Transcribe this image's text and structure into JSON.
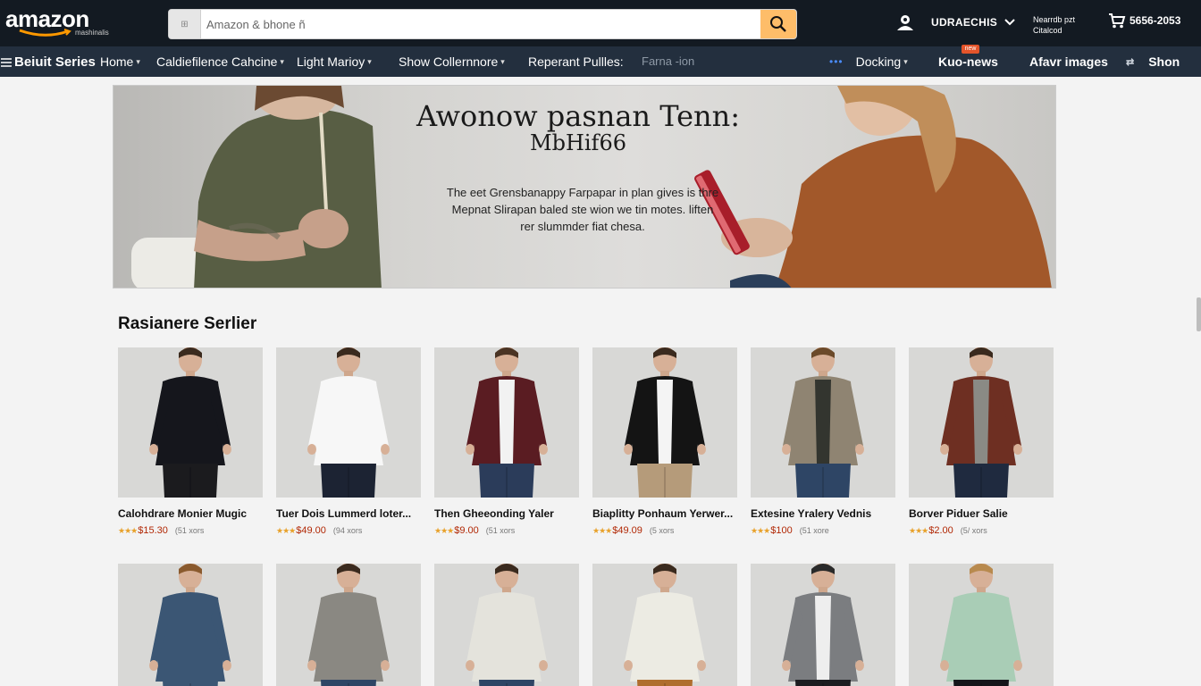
{
  "header": {
    "logo_text": "amazon",
    "logo_sub": "mashinalis",
    "search_placeholder": "Amazon & bhone ñ",
    "account_label": "UDRAECHIS",
    "orders_line1": "Nearrdb pzt",
    "orders_line2": "Citalcod",
    "cart_text": "5656-2053"
  },
  "nav": {
    "items": [
      {
        "label": "Beiuit Series",
        "style": "bold",
        "caret": false
      },
      {
        "label": "Home",
        "style": "normal",
        "caret": true
      },
      {
        "label": "Caldiefilence Cahcine",
        "style": "normal",
        "caret": true
      },
      {
        "label": "Light Marioy",
        "style": "normal",
        "caret": true
      },
      {
        "label": "Show Collernnore",
        "style": "normal",
        "caret": true
      },
      {
        "label": "Reperant Pullles:",
        "style": "normal",
        "caret": false
      },
      {
        "label": "Farna -ion",
        "style": "dim",
        "caret": false
      },
      {
        "label": "Docking",
        "style": "normal",
        "caret": true
      },
      {
        "label": "Kuo-news",
        "style": "bold",
        "caret": false
      },
      {
        "label": "Afavr images",
        "style": "bold",
        "caret": false
      },
      {
        "label": "Shon",
        "style": "bold",
        "caret": false
      }
    ],
    "badge": "new"
  },
  "hero": {
    "title": "Awonow pasnan Tenn:",
    "subtitle": "MbHif66",
    "body": "The eet Grensbanappy Farpapar in plan gives is thre Mepnat Slirapan baled ste wion we tin motes. liften rer slummder fiat chesa."
  },
  "section": {
    "title": "Rasianere Serlier"
  },
  "products": [
    {
      "name": "Calohdrare Monier Mugic",
      "price": "$15.30",
      "reviews": "(51 xors",
      "shirt": "#15161c",
      "pants": "#1b1b1e",
      "inner": "#15161c",
      "open": false,
      "hair": "#3a2a1e"
    },
    {
      "name": "Tuer Dois Lummerd loter...",
      "price": "$49.00",
      "reviews": "(94 xors",
      "shirt": "#f7f7f7",
      "pants": "#1c2333",
      "inner": "#f7f7f7",
      "open": false,
      "hair": "#3a2a1e"
    },
    {
      "name": "Then Gheeonding Yaler",
      "price": "$9.00",
      "reviews": "(51 xors",
      "shirt": "#5a1c22",
      "pants": "#2b3c5a",
      "inner": "#f2f2f2",
      "open": true,
      "hair": "#4a3424"
    },
    {
      "name": "Biaplitty Ponhaum Yerwer...",
      "price": "$49.09",
      "reviews": "(5 xors",
      "shirt": "#141414",
      "pants": "#b59b7a",
      "inner": "#f4f4f4",
      "open": true,
      "hair": "#3a2a1e"
    },
    {
      "name": "Extesine Yralery Vednis",
      "price": "$100",
      "reviews": "(51 xore",
      "shirt": "#8f8472",
      "pants": "#2e4565",
      "inner": "#33352f",
      "open": true,
      "hair": "#6b4a2a"
    },
    {
      "name": "Borver Piduer Salie",
      "price": "$2.00",
      "reviews": "(5/ xors",
      "shirt": "#6e2f22",
      "pants": "#1f2a3f",
      "inner": "#8a8a85",
      "open": true,
      "hair": "#3a2a1e"
    }
  ],
  "products_row2": [
    {
      "shirt": "#3b5674",
      "pants": "#3b5674",
      "inner": "#3b5674",
      "open": false,
      "hair": "#8a5a2e"
    },
    {
      "shirt": "#8a8882",
      "pants": "#2e4565",
      "inner": "#8a8882",
      "open": false,
      "hair": "#3a2a1e"
    },
    {
      "shirt": "#e4e3dc",
      "pants": "#2e4565",
      "inner": "#e4e3dc",
      "open": false,
      "hair": "#3a2a1e"
    },
    {
      "shirt": "#ecebe3",
      "pants": "#b06e2e",
      "inner": "#ecebe3",
      "open": false,
      "hair": "#3a2a1e"
    },
    {
      "shirt": "#7b7d80",
      "pants": "#1c1c20",
      "inner": "#eeeeee",
      "open": true,
      "hair": "#2a2a2a"
    },
    {
      "shirt": "#a9cdb6",
      "pants": "#15151a",
      "inner": "#a9cdb6",
      "open": false,
      "hair": "#b88a4e"
    }
  ]
}
